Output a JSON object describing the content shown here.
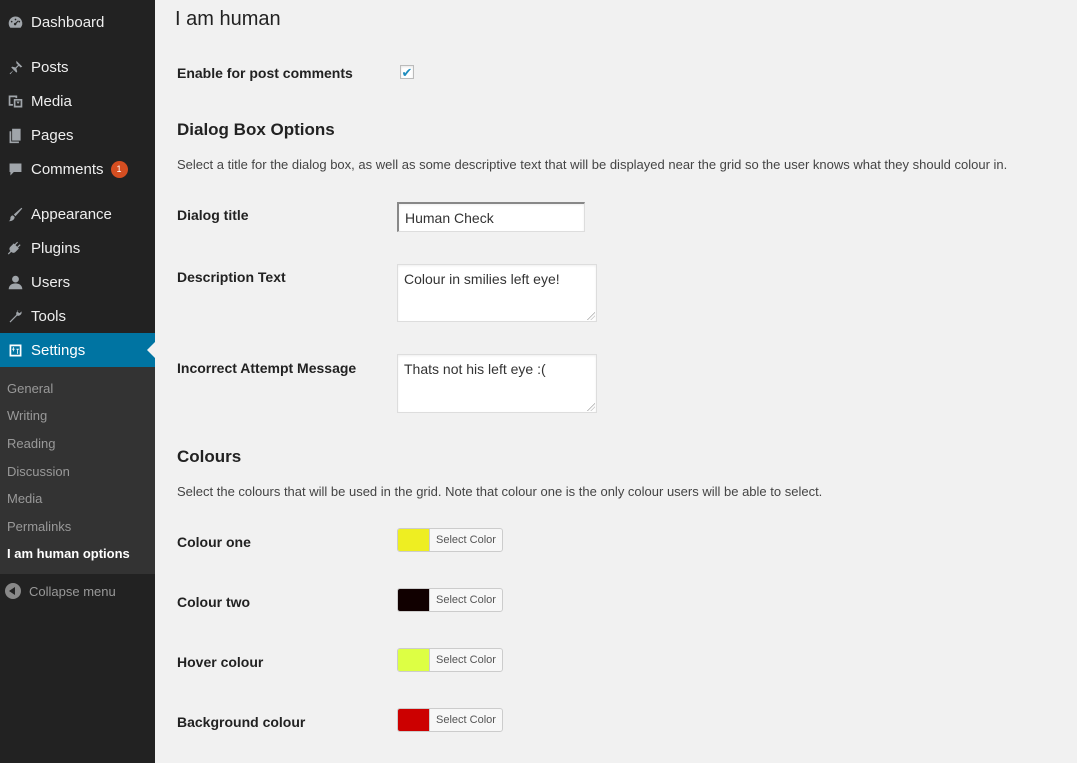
{
  "sidebar": {
    "menu": [
      {
        "id": "dashboard",
        "label": "Dashboard",
        "icon": "dashboard-icon"
      },
      {
        "id": "posts",
        "label": "Posts",
        "icon": "pin-icon"
      },
      {
        "id": "media",
        "label": "Media",
        "icon": "media-icon"
      },
      {
        "id": "pages",
        "label": "Pages",
        "icon": "pages-icon"
      },
      {
        "id": "comments",
        "label": "Comments",
        "icon": "comment-icon",
        "badge": "1"
      },
      {
        "id": "appearance",
        "label": "Appearance",
        "icon": "brush-icon"
      },
      {
        "id": "plugins",
        "label": "Plugins",
        "icon": "plug-icon"
      },
      {
        "id": "users",
        "label": "Users",
        "icon": "user-icon"
      },
      {
        "id": "tools",
        "label": "Tools",
        "icon": "wrench-icon"
      },
      {
        "id": "settings",
        "label": "Settings",
        "icon": "settings-icon"
      }
    ],
    "submenu": [
      "General",
      "Writing",
      "Reading",
      "Discussion",
      "Media",
      "Permalinks",
      "I am human options"
    ],
    "current_submenu": "I am human options",
    "collapse_label": "Collapse menu"
  },
  "page": {
    "title": "I am human",
    "enable_label": "Enable for post comments",
    "enable_checked": true,
    "dialog_section_title": "Dialog Box Options",
    "dialog_section_desc": "Select a title for the dialog box, as well as some descriptive text that will be displayed near the grid so the user knows what they should colour in.",
    "dialog_title_label": "Dialog title",
    "dialog_title_value": "Human Check",
    "description_label": "Description Text",
    "description_value": "Colour in smilies left eye!",
    "incorrect_label": "Incorrect Attempt Message",
    "incorrect_value": "Thats not his left eye :(",
    "colours_section_title": "Colours",
    "colours_section_desc": "Select the colours that will be used in the grid. Note that colour one is the only colour users will be able to select.",
    "colours": [
      {
        "label": "Colour one",
        "color": "#eeee22",
        "button": "Select Color"
      },
      {
        "label": "Colour two",
        "color": "#110000",
        "button": "Select Color"
      },
      {
        "label": "Hover colour",
        "color": "#ddff44",
        "button": "Select Color"
      },
      {
        "label": "Background colour",
        "color": "#cc0000",
        "button": "Select Color"
      }
    ]
  },
  "colors": {
    "sidebar_bg": "#222222",
    "submenu_bg": "#333333",
    "active_bg": "#0074a2",
    "badge_bg": "#d54e21",
    "content_bg": "#f1f1f1"
  }
}
